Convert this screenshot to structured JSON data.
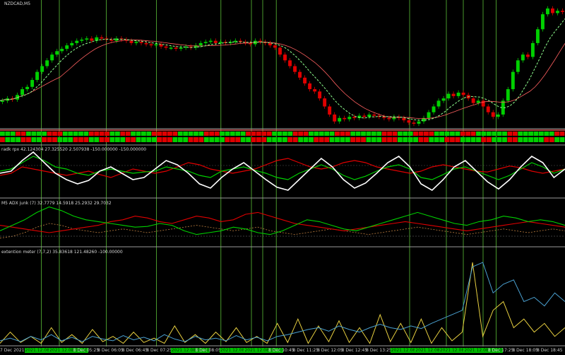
{
  "symbol": "NZDCAD,M5",
  "colors": {
    "background": "#000000",
    "bull": "#00d000",
    "bear": "#e00000",
    "ma_dashed": "#8fff8f",
    "ma_red": "#ff6060",
    "vline": "#7aff4a",
    "white": "#ffffff",
    "blue_line": "#4aa0d0",
    "yellow_line": "#e8d040",
    "separator": "#9a9a9a"
  },
  "panels": {
    "rsi_label": "radk rpx 42.124304 27.325520 2.507938 -150.000000 -150.000000",
    "adx_label": "M5 ADX junk (7) 32.7779 14.5918 25.2932 29.7032",
    "ext_label": "extention meter (7,7,2) 35.83618 121.48260 -100.00000"
  },
  "time_axis": [
    {
      "text": "7 Dec 2021",
      "hl": false
    },
    {
      "text": "2021.12.08 00:55",
      "hl": true
    },
    {
      "text": "2021.12.08 04:30",
      "hl": true
    },
    {
      "text": "8 Dec 05:25",
      "hl": false
    },
    {
      "text": "8 Dec 06:05",
      "hl": false
    },
    {
      "text": "8 Dec 06:45",
      "hl": false
    },
    {
      "text": "8 Dec 07:25",
      "hl": false
    },
    {
      "text": "2021.12.08 07:10",
      "hl": true
    },
    {
      "text": "8 Dec 08:05",
      "hl": false
    },
    {
      "text": "2021.12.08 08:50",
      "hl": true
    },
    {
      "text": "2021.12.08 09:40",
      "hl": true
    },
    {
      "text": "8 Dec 10:45",
      "hl": false
    },
    {
      "text": "8 Dec 11:25",
      "hl": false
    },
    {
      "text": "8 Dec 12:05",
      "hl": false
    },
    {
      "text": "8 Dec 12:45",
      "hl": false
    },
    {
      "text": "8 Dec 13:25",
      "hl": false
    },
    {
      "text": "2021.12.08 14:40",
      "hl": true
    },
    {
      "text": "2021.12.08 15:05",
      "hl": true
    },
    {
      "text": "2021.12.08 16:00",
      "hl": true
    },
    {
      "text": "2021.12.08 17:00",
      "hl": true
    },
    {
      "text": "8 Dec 17:25",
      "hl": false
    },
    {
      "text": "8 Dec 18:05",
      "hl": false
    },
    {
      "text": "8 Dec 18:45",
      "hl": false
    }
  ],
  "chart_data": {
    "type": "line",
    "title": "NZDCAD,M5",
    "price_closes": [
      0.2,
      0.22,
      0.21,
      0.25,
      0.3,
      0.32,
      0.38,
      0.45,
      0.5,
      0.55,
      0.6,
      0.63,
      0.65,
      0.68,
      0.7,
      0.72,
      0.73,
      0.74,
      0.72,
      0.75,
      0.74,
      0.73,
      0.72,
      0.74,
      0.73,
      0.72,
      0.7,
      0.71,
      0.7,
      0.69,
      0.68,
      0.69,
      0.67,
      0.66,
      0.66,
      0.65,
      0.66,
      0.67,
      0.66,
      0.68,
      0.7,
      0.71,
      0.72,
      0.7,
      0.71,
      0.7,
      0.71,
      0.72,
      0.71,
      0.7,
      0.69,
      0.72,
      0.71,
      0.7,
      0.68,
      0.66,
      0.6,
      0.55,
      0.5,
      0.45,
      0.4,
      0.35,
      0.3,
      0.28,
      0.22,
      0.15,
      0.08,
      0.02,
      0.05,
      0.04,
      0.06,
      0.05,
      0.07,
      0.06,
      0.08,
      0.07,
      0.06,
      0.05,
      0.04,
      0.06,
      0.05,
      0.03,
      0.01,
      0.0,
      0.02,
      0.05,
      0.1,
      0.15,
      0.2,
      0.22,
      0.26,
      0.24,
      0.27,
      0.25,
      0.22,
      0.18,
      0.2,
      0.15,
      0.1,
      0.06,
      0.08,
      0.2,
      0.3,
      0.45,
      0.55,
      0.6,
      0.58,
      0.7,
      0.82,
      0.95,
      1.0,
      0.96,
      0.98,
      0.97
    ],
    "rsi_green": [
      0.5,
      0.55,
      0.7,
      0.85,
      0.75,
      0.6,
      0.55,
      0.45,
      0.4,
      0.5,
      0.55,
      0.5,
      0.45,
      0.48,
      0.5,
      0.6,
      0.55,
      0.5,
      0.4,
      0.35,
      0.5,
      0.55,
      0.6,
      0.52,
      0.45,
      0.35,
      0.3,
      0.45,
      0.55,
      0.65,
      0.55,
      0.4,
      0.3,
      0.38,
      0.5,
      0.6,
      0.65,
      0.55,
      0.35,
      0.3,
      0.42,
      0.55,
      0.6,
      0.5,
      0.4,
      0.3,
      0.4,
      0.55,
      0.7,
      0.6,
      0.45,
      0.55
    ],
    "rsi_red": [
      0.4,
      0.45,
      0.6,
      0.55,
      0.5,
      0.45,
      0.4,
      0.45,
      0.5,
      0.42,
      0.35,
      0.45,
      0.55,
      0.5,
      0.45,
      0.5,
      0.6,
      0.7,
      0.65,
      0.55,
      0.5,
      0.45,
      0.5,
      0.55,
      0.65,
      0.75,
      0.8,
      0.7,
      0.6,
      0.55,
      0.6,
      0.7,
      0.75,
      0.7,
      0.6,
      0.55,
      0.5,
      0.45,
      0.5,
      0.6,
      0.65,
      0.6,
      0.55,
      0.5,
      0.48,
      0.55,
      0.62,
      0.58,
      0.5,
      0.45,
      0.5,
      0.55
    ],
    "rsi_white": [
      0.45,
      0.5,
      0.75,
      0.95,
      0.7,
      0.45,
      0.3,
      0.2,
      0.28,
      0.5,
      0.6,
      0.45,
      0.3,
      0.35,
      0.55,
      0.75,
      0.65,
      0.45,
      0.2,
      0.1,
      0.35,
      0.55,
      0.7,
      0.5,
      0.3,
      0.12,
      0.05,
      0.3,
      0.55,
      0.8,
      0.6,
      0.3,
      0.1,
      0.22,
      0.45,
      0.7,
      0.85,
      0.6,
      0.2,
      0.05,
      0.3,
      0.6,
      0.75,
      0.5,
      0.25,
      0.08,
      0.3,
      0.6,
      0.85,
      0.7,
      0.35,
      0.55
    ],
    "adx_green": [
      0.3,
      0.45,
      0.6,
      0.8,
      0.95,
      0.85,
      0.7,
      0.6,
      0.55,
      0.5,
      0.45,
      0.4,
      0.42,
      0.5,
      0.45,
      0.3,
      0.2,
      0.25,
      0.3,
      0.4,
      0.35,
      0.25,
      0.2,
      0.3,
      0.45,
      0.6,
      0.55,
      0.45,
      0.35,
      0.3,
      0.4,
      0.5,
      0.6,
      0.7,
      0.8,
      0.7,
      0.6,
      0.5,
      0.45,
      0.55,
      0.6,
      0.7,
      0.65,
      0.55,
      0.6,
      0.55,
      0.45
    ],
    "adx_red": [
      0.45,
      0.4,
      0.35,
      0.3,
      0.25,
      0.3,
      0.35,
      0.4,
      0.45,
      0.55,
      0.6,
      0.7,
      0.65,
      0.55,
      0.5,
      0.6,
      0.7,
      0.65,
      0.55,
      0.6,
      0.75,
      0.8,
      0.7,
      0.6,
      0.5,
      0.45,
      0.4,
      0.35,
      0.3,
      0.35,
      0.4,
      0.45,
      0.5,
      0.55,
      0.5,
      0.45,
      0.4,
      0.35,
      0.3,
      0.35,
      0.4,
      0.45,
      0.5,
      0.55,
      0.5,
      0.45,
      0.4
    ],
    "adx_dotted": [
      0.1,
      0.15,
      0.25,
      0.4,
      0.5,
      0.45,
      0.35,
      0.3,
      0.25,
      0.3,
      0.35,
      0.3,
      0.25,
      0.3,
      0.35,
      0.4,
      0.45,
      0.4,
      0.35,
      0.3,
      0.35,
      0.4,
      0.3,
      0.25,
      0.2,
      0.25,
      0.3,
      0.35,
      0.3,
      0.25,
      0.2,
      0.25,
      0.3,
      0.35,
      0.4,
      0.35,
      0.3,
      0.25,
      0.2,
      0.25,
      0.3,
      0.35,
      0.3,
      0.25,
      0.3,
      0.35,
      0.3
    ],
    "ext_blue": [
      0.05,
      0.08,
      0.04,
      0.1,
      0.06,
      0.12,
      0.05,
      0.09,
      0.04,
      0.1,
      0.07,
      0.05,
      0.11,
      0.06,
      0.09,
      0.05,
      0.12,
      0.07,
      0.04,
      0.1,
      0.06,
      0.08,
      0.05,
      0.11,
      0.06,
      0.09,
      0.05,
      0.1,
      0.12,
      0.15,
      0.18,
      0.2,
      0.16,
      0.22,
      0.18,
      0.15,
      0.2,
      0.24,
      0.2,
      0.18,
      0.22,
      0.19,
      0.25,
      0.3,
      0.35,
      0.4,
      0.9,
      0.95,
      0.6,
      0.7,
      0.75,
      0.5,
      0.55,
      0.45,
      0.6,
      0.5
    ],
    "ext_yellow": [
      0.02,
      0.15,
      0.03,
      0.1,
      0.02,
      0.2,
      0.03,
      0.12,
      0.02,
      0.18,
      0.04,
      0.1,
      0.02,
      0.15,
      0.03,
      0.08,
      0.02,
      0.22,
      0.03,
      0.12,
      0.02,
      0.15,
      0.04,
      0.2,
      0.03,
      0.1,
      0.02,
      0.25,
      0.03,
      0.3,
      0.02,
      0.22,
      0.04,
      0.28,
      0.03,
      0.2,
      0.02,
      0.35,
      0.04,
      0.25,
      0.03,
      0.3,
      0.02,
      0.2,
      0.05,
      0.15,
      0.95,
      0.1,
      0.4,
      0.5,
      0.2,
      0.3,
      0.15,
      0.25,
      0.1,
      0.2
    ],
    "signal_strip": [
      1,
      1,
      1,
      0,
      0,
      1,
      1,
      1,
      1,
      0,
      0,
      0,
      1,
      1,
      1,
      1,
      1,
      0,
      0,
      0,
      0,
      1,
      1,
      0,
      0,
      1,
      1,
      1,
      1,
      0,
      0,
      0,
      0,
      0,
      1,
      1,
      1,
      1,
      1,
      0,
      0,
      0,
      1,
      1,
      1,
      1,
      1,
      0,
      0,
      0,
      0,
      0,
      1,
      1,
      1,
      1,
      0,
      0,
      0,
      1,
      1,
      1,
      1,
      1,
      0,
      0,
      0,
      1,
      1,
      1,
      1,
      1,
      1,
      0,
      0,
      0,
      1,
      1,
      1,
      0,
      0,
      0,
      0,
      1,
      1,
      1,
      1,
      1,
      0,
      0,
      0,
      1,
      1,
      1,
      1,
      1,
      1,
      0,
      0,
      1,
      1,
      1,
      1,
      1,
      1,
      1,
      0,
      0
    ],
    "signal_strip2": [
      0,
      1,
      1,
      1,
      0,
      0,
      1,
      1,
      0,
      0,
      0,
      1,
      1,
      1,
      0,
      0,
      0,
      1,
      1,
      0,
      0,
      1,
      1,
      1,
      0,
      0,
      1,
      1,
      1,
      1,
      0,
      0,
      0,
      1,
      1,
      1,
      0,
      0,
      0,
      1,
      1,
      1,
      1,
      0,
      0,
      0,
      1,
      1,
      0,
      0,
      0,
      1,
      1,
      1,
      1,
      0,
      0,
      1,
      1,
      1,
      0,
      0,
      0,
      1,
      1,
      1,
      1,
      0,
      0,
      0,
      1,
      1,
      1,
      0,
      0,
      0,
      1,
      1,
      1,
      1,
      0,
      0,
      1,
      1,
      1,
      0,
      0,
      0,
      1,
      1,
      1,
      1,
      0,
      0,
      1,
      1,
      1,
      0,
      0,
      1,
      1,
      1,
      1,
      1,
      0,
      0,
      1,
      1
    ],
    "vertical_markers": [
      0.073,
      0.105,
      0.188,
      0.277,
      0.391,
      0.445,
      0.465,
      0.489,
      0.725,
      0.79,
      0.82,
      0.855,
      0.878
    ]
  }
}
